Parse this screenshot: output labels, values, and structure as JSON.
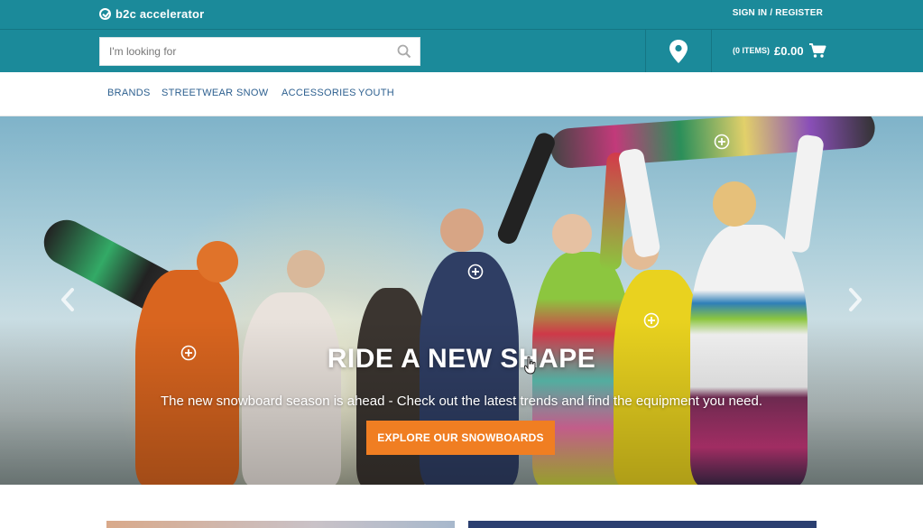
{
  "header": {
    "logo_text": "b2c accelerator",
    "signin_label": "SIGN IN / REGISTER",
    "accent_color": "#1b8a9a"
  },
  "search": {
    "placeholder": "I'm looking for",
    "value": "",
    "icon": "search-icon"
  },
  "store_locator": {
    "icon": "map-pin-icon"
  },
  "cart": {
    "items_label": "(0 ITEMS)",
    "total": "£0.00",
    "icon": "cart-icon"
  },
  "nav": {
    "items": [
      {
        "label": "BRANDS"
      },
      {
        "label": "STREETWEAR"
      },
      {
        "label": "SNOW"
      },
      {
        "label": "ACCESSORIES"
      },
      {
        "label": "YOUTH"
      }
    ]
  },
  "hero": {
    "title": "RIDE A NEW SHAPE",
    "subtitle": "The new snowboard season is ahead - Check out the latest trends and find the equipment you need.",
    "cta_label": "EXPLORE OUR SNOWBOARDS",
    "cta_color": "#f07e22",
    "prev_icon": "chevron-left-icon",
    "next_icon": "chevron-right-icon",
    "hotspot_icon": "plus-circle-icon"
  }
}
